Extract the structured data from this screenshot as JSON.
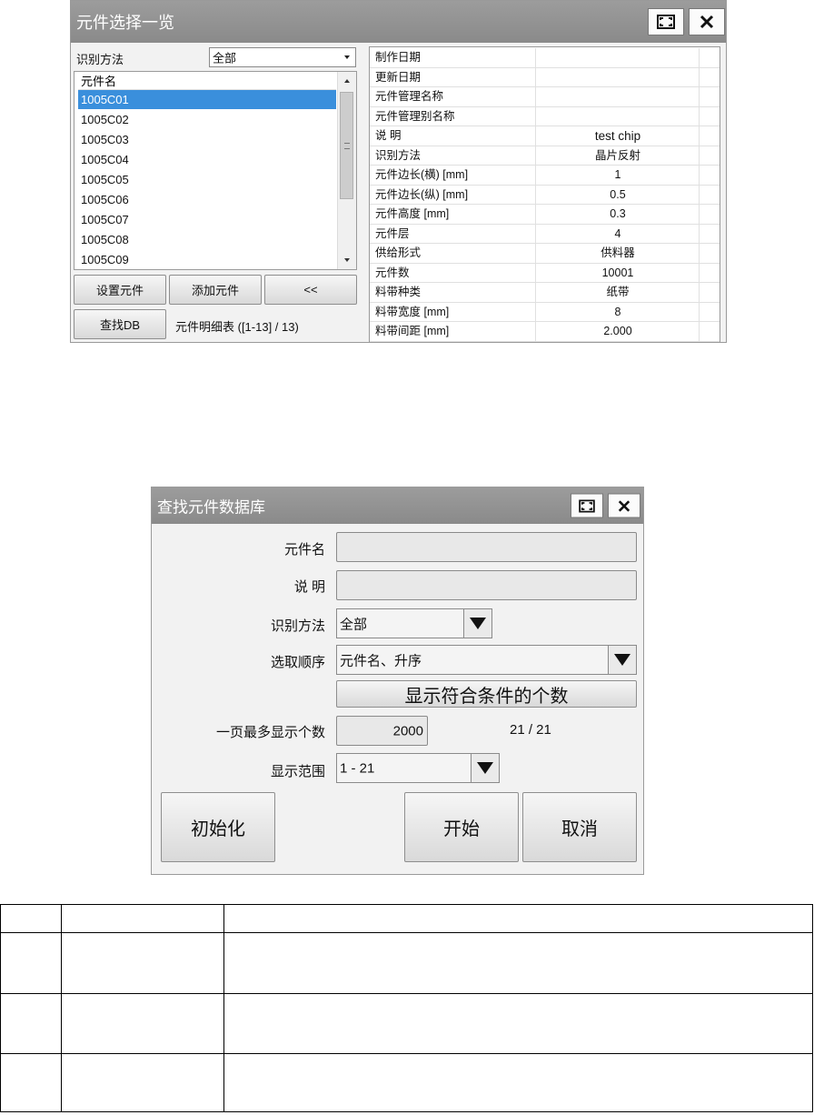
{
  "component_window": {
    "title": "元件选择一览",
    "recognition_label": "识别方法",
    "recognition_value": "全部",
    "list_header": "元件名",
    "items": [
      "1005C01",
      "1005C02",
      "1005C03",
      "1005C04",
      "1005C05",
      "1005C06",
      "1005C07",
      "1005C08",
      "1005C09"
    ],
    "selected_index": 0,
    "buttons": {
      "set": "设置元件",
      "add": "添加元件",
      "back": "<<",
      "find_db": "查找DB"
    },
    "detail_label": "元件明细表 ([1-13] / 13)",
    "properties": [
      {
        "name": "制作日期",
        "value": ""
      },
      {
        "name": "更新日期",
        "value": ""
      },
      {
        "name": "元件管理名称",
        "value": ""
      },
      {
        "name": "元件管理别名称",
        "value": ""
      },
      {
        "name": "说 明",
        "value": "test chip"
      },
      {
        "name": "识别方法",
        "value": "晶片反射"
      },
      {
        "name": "元件边长(横) [mm]",
        "value": "1"
      },
      {
        "name": "元件边长(纵) [mm]",
        "value": "0.5"
      },
      {
        "name": "元件高度 [mm]",
        "value": "0.3"
      },
      {
        "name": "元件层",
        "value": "4"
      },
      {
        "name": "供给形式",
        "value": "供料器"
      },
      {
        "name": "元件数",
        "value": "10001"
      },
      {
        "name": "料带种类",
        "value": "纸带"
      },
      {
        "name": "料带宽度 [mm]",
        "value": "8"
      },
      {
        "name": "料带间距 [mm]",
        "value": "2.000"
      }
    ]
  },
  "search_window": {
    "title": "查找元件数据库",
    "name_label": "元件名",
    "name_value": "",
    "desc_label": "说 明",
    "desc_value": "",
    "recognition_label": "识别方法",
    "recognition_value": "全部",
    "order_label": "选取顺序",
    "order_value": "元件名、升序",
    "count_button": "显示符合条件的个数",
    "max_label": "一页最多显示个数",
    "max_value": "2000",
    "count_value": "21 / 21",
    "range_label": "显示范围",
    "range_value": "1 - 21",
    "buttons": {
      "init": "初始化",
      "start": "开始",
      "cancel": "取消"
    }
  },
  "icons": {
    "maximize": "maximize-icon",
    "close": "close-icon",
    "dropdown": "triangle-down-icon"
  },
  "colors": {
    "titlebar": "#8f8f8f",
    "selection": "#3a8fdc"
  }
}
